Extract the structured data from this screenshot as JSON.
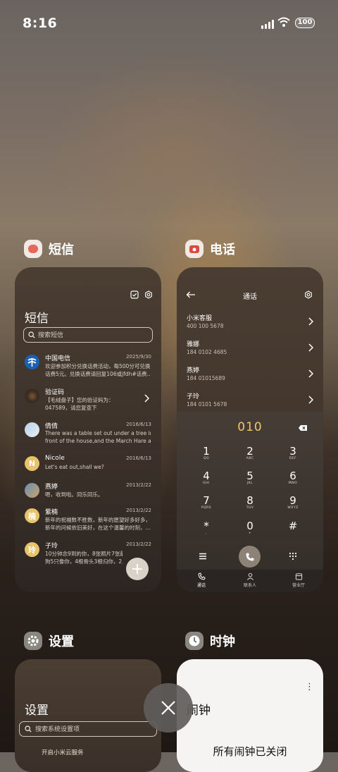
{
  "status": {
    "time": "8:16",
    "battery": "100"
  },
  "apps": {
    "sms": {
      "name": "短信",
      "title": "短信",
      "search_placeholder": "搜索短信",
      "messages": [
        {
          "name": "中国电信",
          "date": "2025/9/30",
          "line1": "欢迎参加积分兑换话费活动，每500分可兑换",
          "line2": "话费5元。兑换话费请回复106或jfdh#话费..."
        },
        {
          "name": "验证码",
          "date": "",
          "line1": "【毛绒盘子】您的验证码为：",
          "line2": "047589，请您复查下"
        },
        {
          "name": "倩倩",
          "date": "2016/6/13",
          "line1": "There was a table set out under a tree in",
          "line2": "front of the house,and the March Hare an..."
        },
        {
          "name": "Nicole",
          "date": "2016/6/13",
          "line1": "Let's eat out,shall we?",
          "line2": ""
        },
        {
          "name": "燕婷",
          "date": "2013/2/22",
          "line1": "嗯，收到啦。同乐同乐。",
          "line2": ""
        },
        {
          "name": "紫楠",
          "date": "2013/2/22",
          "line1": "新年的祝福数不胜数，新年的愿望好多好多，",
          "line2": "新年的问候依旧美好，在这个温馨的时刻，..."
        },
        {
          "name": "子玲",
          "date": "2013/2/22",
          "line1": "10分钟念9到的你，8张照片7张最你，6只小",
          "line2": "狗5只像你，4根骨头3根归你，2爪粮..."
        }
      ],
      "avatar_letters": {
        "nicole": "N",
        "zinan": "楠",
        "ziling": "玲"
      },
      "fab": "+"
    },
    "phone": {
      "name": "电话",
      "title": "通话",
      "contacts": [
        {
          "name": "小米客服",
          "number": "400 100 5678"
        },
        {
          "name": "雅娜",
          "number": "184 0102 4685"
        },
        {
          "name": "燕婷",
          "number": "184 01015689"
        },
        {
          "name": "子玲",
          "number": "184 0101 5678"
        }
      ],
      "dialed": "010",
      "keys": [
        {
          "d": "1",
          "l": "QO"
        },
        {
          "d": "2",
          "l": "ABC"
        },
        {
          "d": "3",
          "l": "DEF"
        },
        {
          "d": "4",
          "l": "GHI"
        },
        {
          "d": "5",
          "l": "JKL"
        },
        {
          "d": "6",
          "l": "MNO"
        },
        {
          "d": "7",
          "l": "PQRS"
        },
        {
          "d": "8",
          "l": "TUV"
        },
        {
          "d": "9",
          "l": "WXYZ"
        },
        {
          "d": "*",
          "l": ","
        },
        {
          "d": "0",
          "l": "+"
        },
        {
          "d": "#",
          "l": ""
        }
      ],
      "tabs": {
        "calls": "通话",
        "contacts": "联系人",
        "yellow_pages": "营业厅"
      }
    },
    "settings": {
      "name": "设置",
      "title": "设置",
      "search_placeholder": "搜索系统设置项",
      "first_item": "开启小米云服务"
    },
    "clock": {
      "name": "时钟",
      "title": "闹钟",
      "message": "所有闹钟已关闭",
      "menu": "⋮"
    }
  },
  "colors": {
    "accent_gold": "#f0c86a",
    "sms_icon": "#e8665a",
    "phone_icon": "#d94b3a"
  }
}
